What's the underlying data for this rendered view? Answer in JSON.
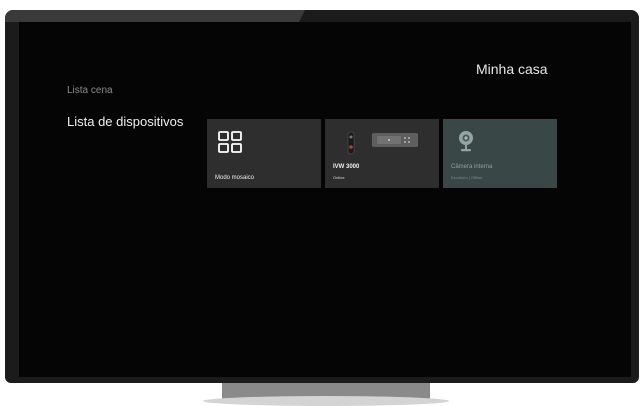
{
  "header": {
    "home_name": "Minha casa"
  },
  "menu": {
    "scene_list": "Lista cena",
    "device_list": "Lista de dispositivos"
  },
  "devices": [
    {
      "title": "Modo mosaico",
      "status": "",
      "icon": "mosaic-grid-icon"
    },
    {
      "title": "IVW 3000",
      "status": "Online",
      "icon": "video-doorbell-icon"
    },
    {
      "title": "Câmera interna",
      "status": "Escritório | Offline",
      "icon": "indoor-camera-icon"
    }
  ],
  "colors": {
    "background": "#050505",
    "card": "#2e2e2e",
    "card_offline": "#3a4747",
    "text_primary": "#f0f0f0",
    "text_muted": "#8b8b8b"
  }
}
